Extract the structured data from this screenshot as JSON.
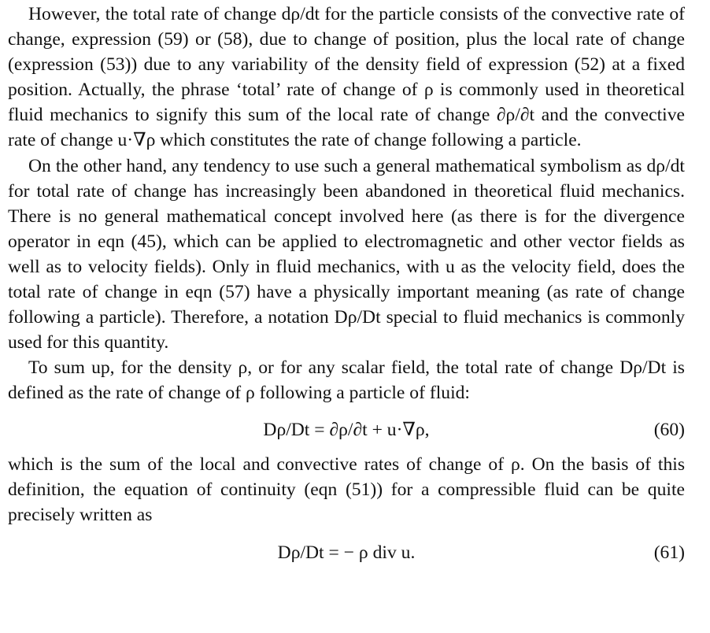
{
  "paragraphs": [
    "However, the total rate of change dρ/dt for the particle consists of the convective rate of change, expression (59) or (58), due to change of position, plus the local rate of change (expression (53)) due to any variability of the density field of expression (52) at a fixed position. Actually, the phrase ‘total’ rate of change of ρ is commonly used in theoretical fluid mechanics to signify this sum of the local rate of change ∂ρ/∂t and the convective rate of change u·∇ρ which constitutes the rate of change following a particle.",
    "On the other hand, any tendency to use such a general mathematical symbolism as dρ/dt for total rate of change has increasingly been abandoned in theoretical fluid mechanics. There is no general mathematical concept involved here (as there is for the divergence operator in eqn (45), which can be applied to electromagnetic and other vector fields as well as to velocity fields). Only in fluid mechanics, with u as the velocity field, does the total rate of change in eqn (57) have a physically important meaning (as rate of change following a particle). Therefore, a notation Dρ/Dt special to fluid mechanics is commonly used for this quantity.",
    "To sum up, for the density ρ, or for any scalar field, the total rate of change Dρ/Dt is defined as the rate of change of ρ following a particle of fluid:",
    "which is the sum of the local and convective rates of change of ρ. On the basis of this definition, the equation of continuity (eqn (51)) for a compressible fluid can be quite precisely written as"
  ],
  "equations": [
    {
      "expression": "Dρ/Dt = ∂ρ/∂t + u·∇ρ,",
      "number": "(60)"
    },
    {
      "expression": "Dρ/Dt = − ρ div u.",
      "number": "(61)"
    }
  ]
}
